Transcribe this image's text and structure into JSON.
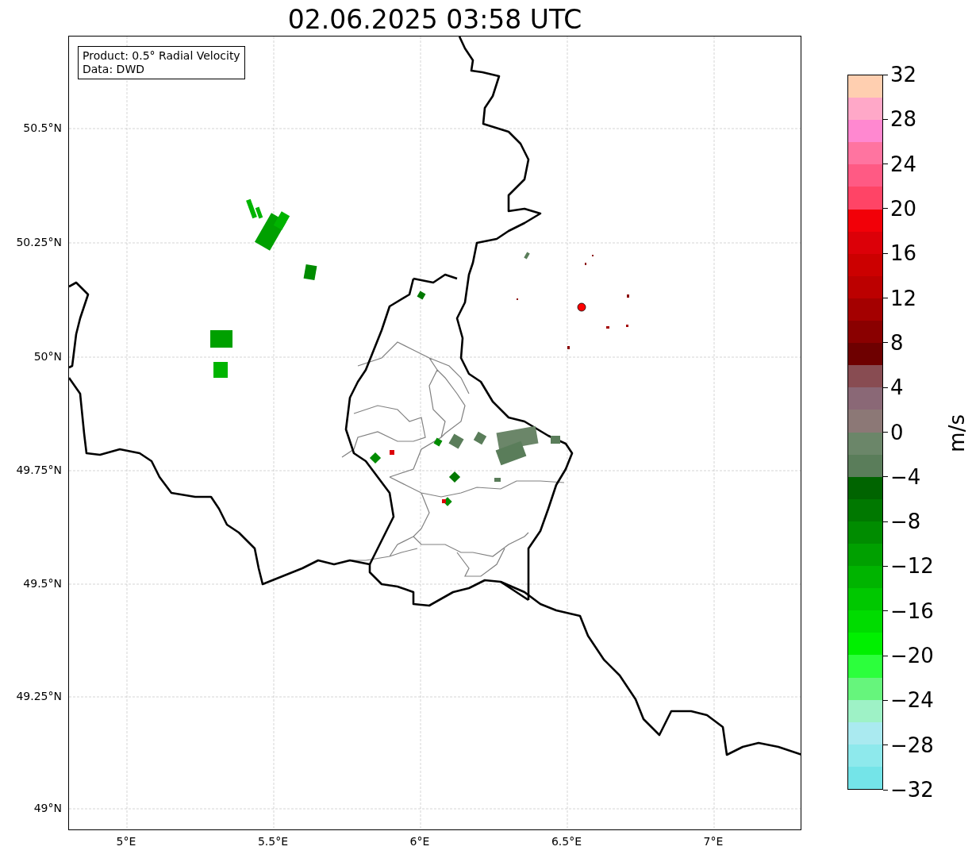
{
  "title": "02.06.2025 03:58 UTC",
  "info_box": [
    "Product: 0.5° Radial Velocity",
    "Data: DWD"
  ],
  "map": {
    "x_tick_labels": [
      "5°E",
      "5.5°E",
      "6°E",
      "6.5°E",
      "7°E"
    ],
    "y_tick_labels": [
      "50.5°N",
      "50.25°N",
      "50°N",
      "49.75°N",
      "49.5°N",
      "49.25°N",
      "49°N"
    ]
  },
  "colorbar": {
    "label": "m/s",
    "tick_labels": [
      "32",
      "28",
      "24",
      "20",
      "16",
      "12",
      "8",
      "4",
      "0",
      "−4",
      "−8",
      "−12",
      "−16",
      "−20",
      "−24",
      "−28",
      "−32"
    ],
    "colors": [
      {
        "color": "#ffcfb0"
      },
      {
        "color": "#ffa8c8"
      },
      {
        "color": "#ff88d0"
      },
      {
        "color": "#ff74a0"
      },
      {
        "color": "#ff5a84"
      },
      {
        "color": "#ff4466"
      },
      {
        "color": "#f20008"
      },
      {
        "color": "#dc0008"
      },
      {
        "color": "#cc0000"
      },
      {
        "color": "#bc0000"
      },
      {
        "color": "#a40000"
      },
      {
        "color": "#8a0000"
      },
      {
        "color": "#6e0000"
      },
      {
        "color": "#884c52"
      },
      {
        "color": "#8a6876"
      },
      {
        "color": "#8c7876"
      },
      {
        "color": "#6b8669"
      },
      {
        "color": "#5a7d5a"
      },
      {
        "color": "#006400"
      },
      {
        "color": "#007800"
      },
      {
        "color": "#008c00"
      },
      {
        "color": "#00a000"
      },
      {
        "color": "#00b400"
      },
      {
        "color": "#00c800"
      },
      {
        "color": "#00dc00"
      },
      {
        "color": "#00f000"
      },
      {
        "color": "#2cff3c"
      },
      {
        "color": "#66f57c"
      },
      {
        "color": "#9ef2c6"
      },
      {
        "color": "#aaeaf0"
      },
      {
        "color": "#8ee9ec"
      },
      {
        "color": "#74e4e8"
      }
    ]
  }
}
